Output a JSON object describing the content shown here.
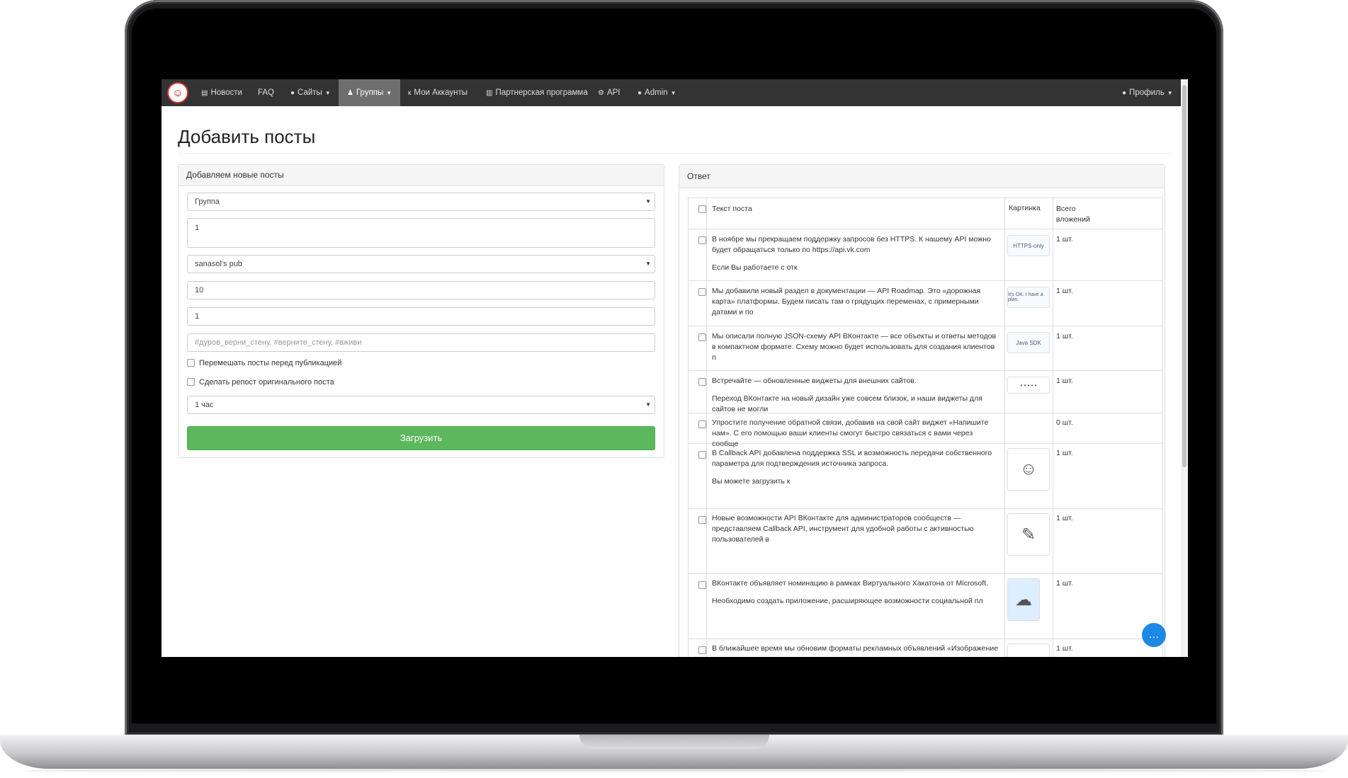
{
  "nav": {
    "items": [
      {
        "label": "Новости",
        "icon": "newspaper-icon",
        "glyph": "▤",
        "caret": false,
        "active": false
      },
      {
        "label": "FAQ",
        "icon": "",
        "glyph": "",
        "caret": false,
        "active": false
      },
      {
        "label": "Сайты",
        "icon": "globe-icon",
        "glyph": "●",
        "caret": true,
        "active": false
      },
      {
        "label": "Группы",
        "icon": "users-icon",
        "glyph": "♟",
        "caret": true,
        "active": true
      },
      {
        "label": "Мои Аккаунты",
        "icon": "vk-icon",
        "glyph": "к",
        "caret": false,
        "active": false
      },
      {
        "label": "Партнерская программа",
        "icon": "building-icon",
        "glyph": "▥",
        "caret": false,
        "active": false
      },
      {
        "label": "API",
        "icon": "cogs-icon",
        "glyph": "⚙",
        "caret": false,
        "active": false
      },
      {
        "label": "Admin",
        "icon": "user-icon",
        "glyph": "●",
        "caret": true,
        "active": false
      }
    ],
    "profile": {
      "label": "Профиль",
      "glyph": "●"
    }
  },
  "page": {
    "title": "Добавить посты"
  },
  "form": {
    "heading": "Добавляем новые посты",
    "group_select": "Группа",
    "ids_textarea": "1",
    "source_select": "sanasol's pub",
    "count_input": "10",
    "offset_input": "1",
    "tags_placeholder": "#дуров_верни_стену, #верните_стену, #вживи",
    "shuffle_label": "Перемешать посты перед публикацией",
    "repost_label": "Сделать репост оригинального поста",
    "interval_select": "1 час",
    "submit_label": "Загрузить"
  },
  "response": {
    "heading": "Ответ",
    "columns": {
      "text": "Текст поста",
      "image": "Картинка",
      "total_line1": "Всего",
      "total_line2": "вложений"
    },
    "rows": [
      {
        "text1": "В ноябре мы прекращаем поддержку запросов без HTTPS. К нашему API можно будет обращаться только по https://api.vk.com",
        "text2": "Если Вы работаете с отк",
        "thumb": "HTTPS-only",
        "count": "1 шт."
      },
      {
        "text1": "Мы добавили новый раздел в документации — API Roadmap. Это «дорожная карта» платформы. Будем писать там о грядущих переменах, с примерными датами и по",
        "text2": "",
        "thumb": "It's OK. I have a plan.",
        "count": "1 шт."
      },
      {
        "text1": "Мы описали полную JSON-схему API ВКонтакте — все объекты и ответы методов в компактном формате. Схему можно будет использовать для создания клиентов п",
        "text2": "",
        "thumb": "Java SDK",
        "count": "1 шт."
      },
      {
        "text1": "Встречайте — обновленные виджеты для внешних сайтов.",
        "text2": "Переход ВКонтакте на новый дизайн уже совсем близок, и наши виджеты для сайтов не могли",
        "thumb": "• • • • •",
        "count": "1 шт."
      },
      {
        "text1": "Упростите получение обратной связи, добавив на свой сайт виджет «Напишите нам». С его помощью ваши клиенты смогут быстро связаться с вами через сообще",
        "text2": "",
        "thumb": "",
        "count": "0 шт."
      },
      {
        "text1": "В Callback API добавлена поддержка SSL и возможность передачи собственного параметра для подтверждения источника запроса.",
        "text2": "Вы можете загрузить к",
        "thumb": "☺",
        "count": "1 шт."
      },
      {
        "text1": "Новые возможности API ВКонтакте для администраторов сообществ — представляем Callback API, инструмент для удобной работы с активностью пользователей в",
        "text2": "",
        "thumb": "✎",
        "count": "1 шт."
      },
      {
        "text1": "ВКонтакте объявляет номинацию в рамках Виртуального Хакатона от Microsoft.",
        "text2": "Необходимо создать приложение, расширяющее возможности социальной пл",
        "thumb": "☁",
        "count": "1 шт."
      },
      {
        "text1": "В ближайшее время мы обновим форматы рекламных объявлений «Изображение и текст» и",
        "text2": "",
        "thumb": "",
        "count": "1 шт."
      }
    ]
  },
  "colors": {
    "navbar": "#333333",
    "active_tab": "#6e6e6e",
    "submit": "#5cb85c",
    "chat": "#1e88e5"
  }
}
